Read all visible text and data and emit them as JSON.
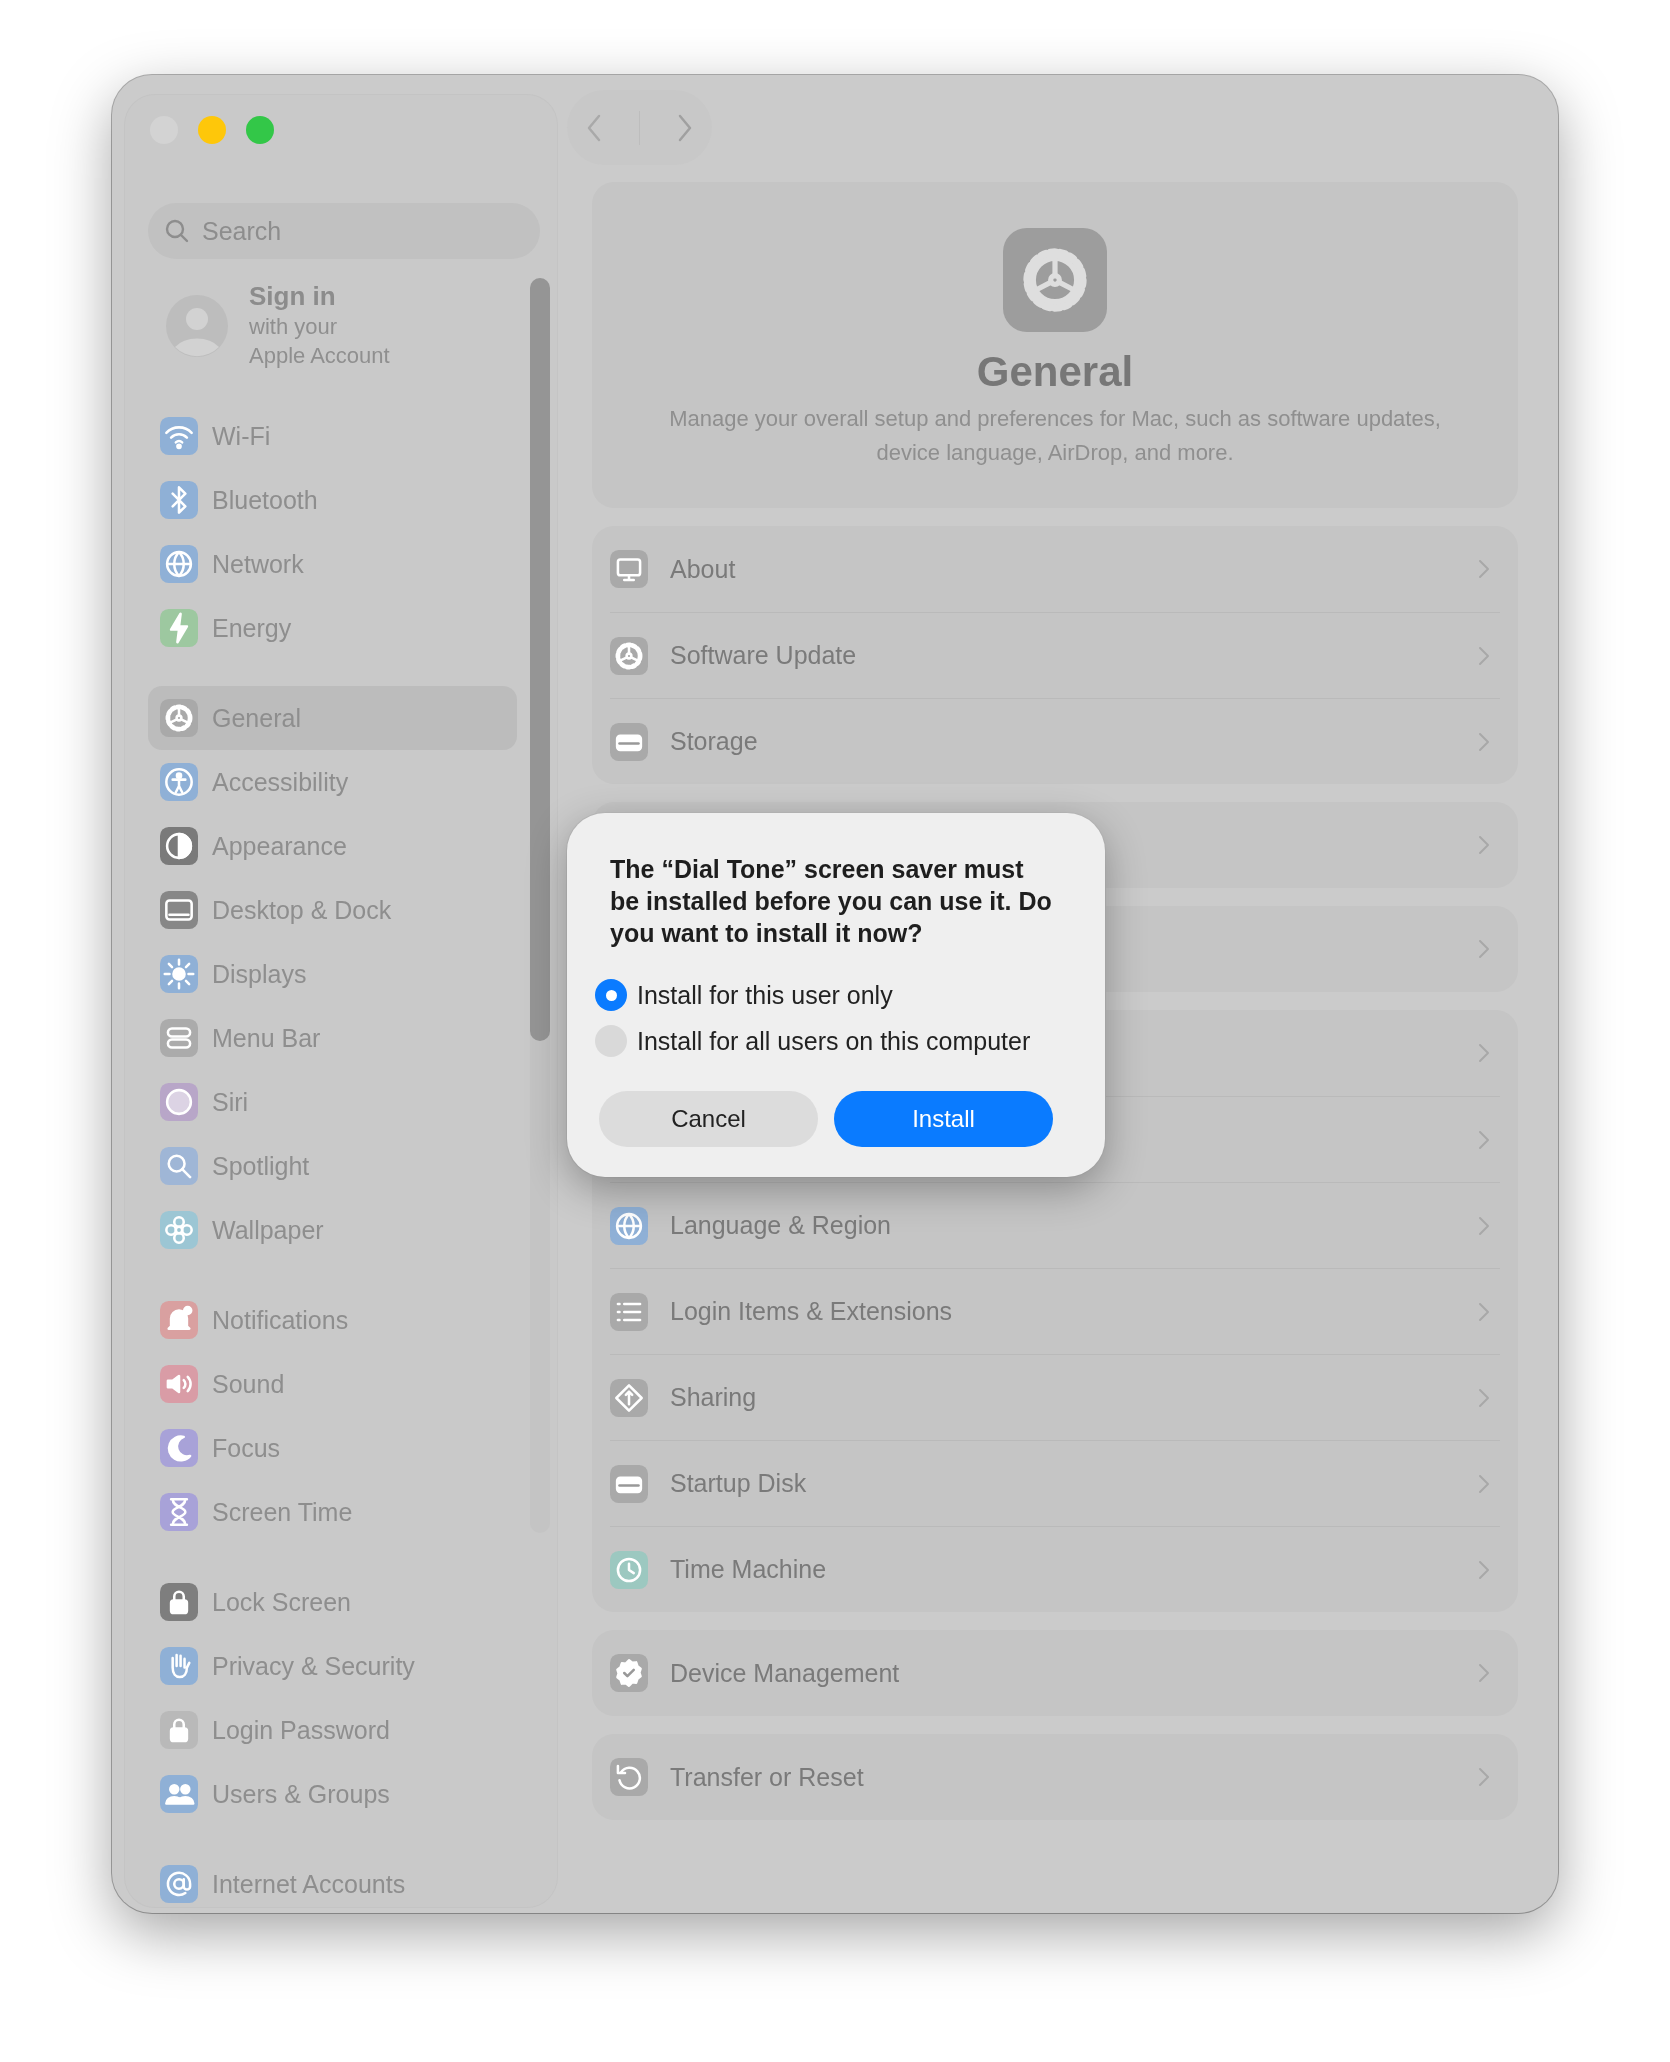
{
  "sidebar": {
    "search": {
      "placeholder": "Search"
    },
    "account": {
      "title": "Sign in",
      "subtitle_lines": [
        "with your",
        "Apple Account"
      ]
    },
    "groups": [
      [
        {
          "label": "Wi-Fi",
          "kind": "wifi",
          "color": "#8fb0d6",
          "selected": false
        },
        {
          "label": "Bluetooth",
          "kind": "bluetooth",
          "color": "#8fb0d6",
          "selected": false
        },
        {
          "label": "Network",
          "kind": "globe",
          "color": "#8fb0d6",
          "selected": false
        },
        {
          "label": "Energy",
          "kind": "bolt",
          "color": "#9dc8a0",
          "selected": false
        }
      ],
      [
        {
          "label": "General",
          "kind": "gear",
          "color": "#a9a9a9",
          "selected": true
        },
        {
          "label": "Accessibility",
          "kind": "person",
          "color": "#8fb0d6",
          "selected": false
        },
        {
          "label": "Appearance",
          "kind": "halfcircle",
          "color": "#7a7a7a",
          "selected": false
        },
        {
          "label": "Desktop & Dock",
          "kind": "dock",
          "color": "#878787",
          "selected": false
        },
        {
          "label": "Displays",
          "kind": "sun",
          "color": "#8fb0d6",
          "selected": false
        },
        {
          "label": "Menu Bar",
          "kind": "toggles",
          "color": "#ababab",
          "selected": false
        },
        {
          "label": "Siri",
          "kind": "orb",
          "color": "#b8a6c8",
          "selected": false
        },
        {
          "label": "Spotlight",
          "kind": "search",
          "color": "#9fb6d6",
          "selected": false
        },
        {
          "label": "Wallpaper",
          "kind": "flower",
          "color": "#9cc6d4",
          "selected": false
        }
      ],
      [
        {
          "label": "Notifications",
          "kind": "bell",
          "color": "#d9a0a0",
          "selected": false
        },
        {
          "label": "Sound",
          "kind": "speaker",
          "color": "#d99ca6",
          "selected": false
        },
        {
          "label": "Focus",
          "kind": "moon",
          "color": "#a8a2d8",
          "selected": false
        },
        {
          "label": "Screen Time",
          "kind": "hourglass",
          "color": "#a8a2d8",
          "selected": false
        }
      ],
      [
        {
          "label": "Lock Screen",
          "kind": "lock",
          "color": "#7e7e7e",
          "selected": false
        },
        {
          "label": "Privacy & Security",
          "kind": "hand",
          "color": "#8fb0d6",
          "selected": false
        },
        {
          "label": "Login Password",
          "kind": "lock",
          "color": "#b9b9b9",
          "selected": false
        },
        {
          "label": "Users & Groups",
          "kind": "people",
          "color": "#8fb0d6",
          "selected": false
        }
      ],
      [
        {
          "label": "Internet Accounts",
          "kind": "at",
          "color": "#8fb0d6",
          "selected": false
        }
      ]
    ]
  },
  "header": {
    "title": "General",
    "description": "Manage your overall setup and preferences for Mac, such as software updates, device language, AirDrop, and more."
  },
  "groups": [
    [
      {
        "kind": "display",
        "label": "About",
        "color": "#a9a9a9"
      },
      {
        "kind": "gear",
        "label": "Software Update",
        "color": "#a9a9a9"
      },
      {
        "kind": "disk",
        "label": "Storage",
        "color": "#a9a9a9"
      }
    ],
    [
      {
        "kind": "covered"
      }
    ],
    [
      {
        "kind": "covered"
      }
    ],
    [
      {
        "kind": "covered"
      },
      {
        "kind": "covered"
      },
      {
        "kind": "globe",
        "label": "Language & Region",
        "color": "#8fb0d6"
      },
      {
        "kind": "list",
        "label": "Login Items & Extensions",
        "color": "#a9a9a9"
      },
      {
        "kind": "diamond",
        "label": "Sharing",
        "color": "#a9a9a9"
      },
      {
        "kind": "disk",
        "label": "Startup Disk",
        "color": "#a9a9a9"
      },
      {
        "kind": "clock",
        "label": "Time Machine",
        "color": "#9cc8c0"
      }
    ],
    [
      {
        "kind": "check",
        "label": "Device Management",
        "color": "#a9a9a9"
      }
    ],
    [
      {
        "kind": "reset",
        "label": "Transfer or Reset",
        "color": "#a9a9a9"
      }
    ]
  ],
  "dialog": {
    "message": "The “Dial Tone” screen saver must be installed before you can use it. Do you want to install it now?",
    "options": [
      {
        "label": "Install for this user only",
        "selected": true
      },
      {
        "label": "Install for all users on this computer",
        "selected": false
      }
    ],
    "buttons": [
      {
        "label": "Cancel",
        "kind": "secondary"
      },
      {
        "label": "Install",
        "kind": "primary"
      }
    ]
  }
}
